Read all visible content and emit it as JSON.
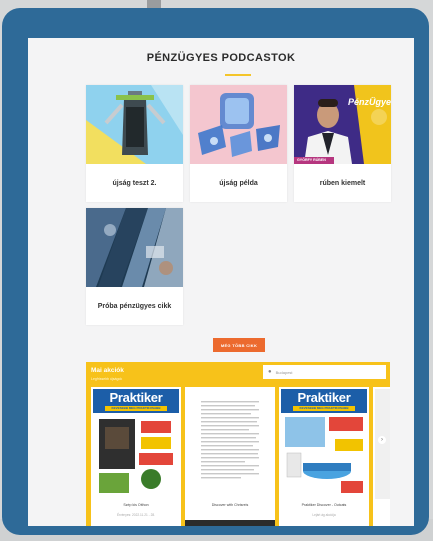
{
  "section": {
    "title": "PÉNZÜGYES PODCASTOK"
  },
  "cards": [
    {
      "label": "újság teszt 2."
    },
    {
      "label": "újság példa"
    },
    {
      "label": "rúben kiemelt"
    },
    {
      "label": "Próba pénzügyes cikk"
    }
  ],
  "more_button": {
    "label": "MÉG TÖBB CIKK"
  },
  "thumb3": {
    "brand": "PénzÜgyes",
    "name": "GYÖRFY RÚBEN"
  },
  "deals": {
    "title": "Mai akciók",
    "subtitle": "Legfrissebb újságok",
    "location_placeholder": "Budapest",
    "next_icon": "chevron-right-icon",
    "flyers": [
      {
        "brand": "Praktiker",
        "tagline": "KEVESEBB MEG PRAKTIKUSABB",
        "name": "Szép kis Otthon",
        "date": "Érvényes: 2022.11.21 - 28."
      },
      {
        "name": "Discover with Chrisreis",
        "date": ""
      },
      {
        "brand": "Praktiker",
        "tagline": "KEVESEBB MEG PRAKTIKUSABB",
        "name": "Praktiker Discover - Outcats",
        "date": "Lejárt ág akciója"
      }
    ]
  },
  "colors": {
    "frame": "#2e6a98",
    "accent": "#f4c52a",
    "button": "#ec6a2e",
    "deals_bg": "#f7c21a"
  }
}
